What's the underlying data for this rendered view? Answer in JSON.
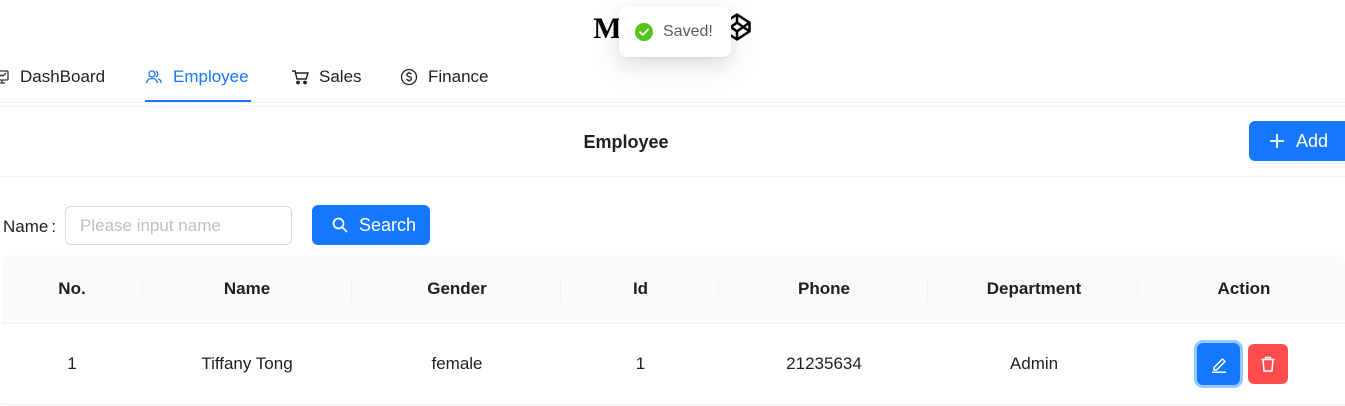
{
  "app": {
    "title": "My E   tem"
  },
  "toast": {
    "message": "Saved!"
  },
  "tabs": [
    {
      "label": "DashBoard",
      "icon": "dashboard-icon",
      "active": false
    },
    {
      "label": "Employee",
      "icon": "users-icon",
      "active": true
    },
    {
      "label": "Sales",
      "icon": "cart-icon",
      "active": false
    },
    {
      "label": "Finance",
      "icon": "dollar-circle-icon",
      "active": false
    }
  ],
  "card": {
    "title": "Employee",
    "add_label": "Add"
  },
  "filter": {
    "name_label": "Name",
    "name_colon": ":",
    "name_value": "",
    "name_placeholder": "Please input name",
    "search_label": "Search"
  },
  "table": {
    "columns": [
      "No.",
      "Name",
      "Gender",
      "Id",
      "Phone",
      "Department",
      "Action"
    ],
    "rows": [
      {
        "no": "1",
        "name": "Tiffany Tong",
        "gender": "female",
        "id": "1",
        "phone": "21235634",
        "department": "Admin"
      }
    ]
  },
  "colors": {
    "primary": "#1677ff",
    "danger": "#ff4d4f",
    "success": "#52c41a"
  }
}
